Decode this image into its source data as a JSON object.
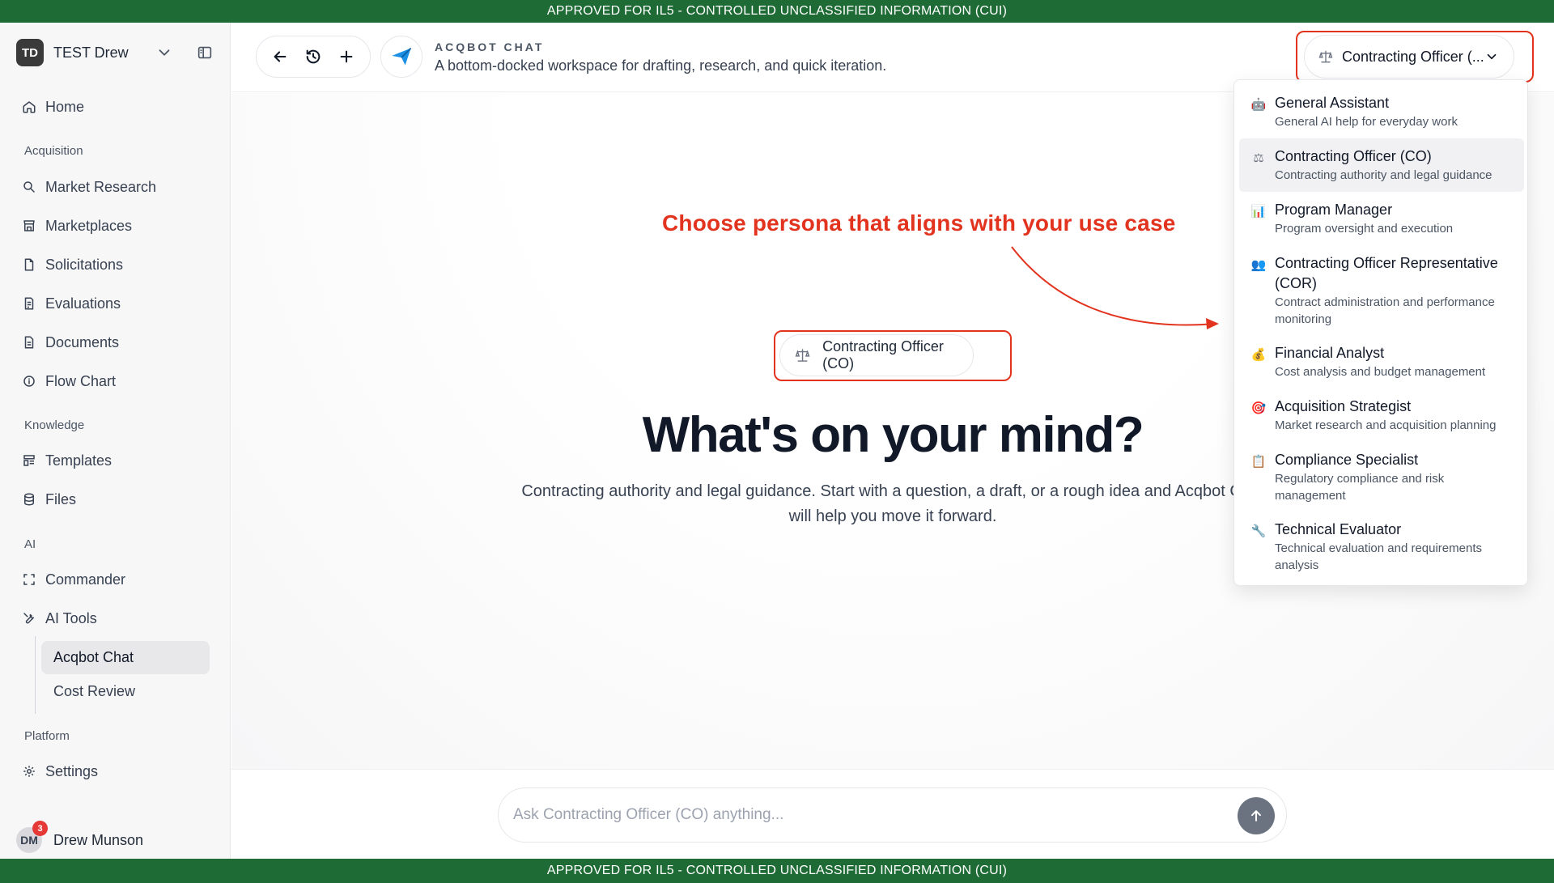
{
  "banner": {
    "top_text": "APPROVED FOR IL5 - CONTROLLED UNCLASSIFIED INFORMATION (CUI)",
    "bottom_text": "APPROVED FOR IL5 - CONTROLLED UNCLASSIFIED INFORMATION (CUI)",
    "color": "#1e6b35"
  },
  "workspace": {
    "initials": "TD",
    "name": "TEST Drew"
  },
  "sidebar": {
    "home": "Home",
    "sections": {
      "acquisition": "Acquisition",
      "knowledge": "Knowledge",
      "ai": "AI",
      "platform": "Platform"
    },
    "acquisition_items": [
      "Market Research",
      "Marketplaces",
      "Solicitations",
      "Evaluations",
      "Documents",
      "Flow Chart"
    ],
    "knowledge_items": [
      "Templates",
      "Files"
    ],
    "ai_items": [
      "Commander",
      "AI Tools"
    ],
    "ai_tools_sub": [
      "Acqbot Chat",
      "Cost Review"
    ],
    "platform_items": [
      "Settings"
    ]
  },
  "user": {
    "initials": "DM",
    "name": "Drew Munson",
    "notifications": "3"
  },
  "header": {
    "app_kicker": "ACQBOT CHAT",
    "app_description": "A bottom-docked workspace for drafting, research, and quick iteration.",
    "persona_selected_label": "Contracting Officer (..."
  },
  "personas": [
    {
      "icon": "robot-icon",
      "emoji": "🤖",
      "title": "General Assistant",
      "subtitle": "General AI help for everyday work"
    },
    {
      "icon": "scales-icon",
      "emoji": "⚖",
      "title": "Contracting Officer (CO)",
      "subtitle": "Contracting authority and legal guidance"
    },
    {
      "icon": "chart-icon",
      "emoji": "📊",
      "title": "Program Manager",
      "subtitle": "Program oversight and execution"
    },
    {
      "icon": "people-icon",
      "emoji": "👥",
      "title": "Contracting Officer Representative (COR)",
      "subtitle": "Contract administration and performance monitoring"
    },
    {
      "icon": "money-bag-icon",
      "emoji": "💰",
      "title": "Financial Analyst",
      "subtitle": "Cost analysis and budget management"
    },
    {
      "icon": "target-icon",
      "emoji": "🎯",
      "title": "Acquisition Strategist",
      "subtitle": "Market research and acquisition planning"
    },
    {
      "icon": "clipboard-icon",
      "emoji": "📋",
      "title": "Compliance Specialist",
      "subtitle": "Regulatory compliance and risk management"
    },
    {
      "icon": "wrench-icon",
      "emoji": "🔧",
      "title": "Technical Evaluator",
      "subtitle": "Technical evaluation and requirements analysis"
    }
  ],
  "main": {
    "annotation": "Choose persona that aligns with your use case",
    "persona_pill": "Contracting Officer (CO)",
    "headline": "What's on your mind?",
    "subheadline": "Contracting authority and legal guidance. Start with a question, a draft, or a rough idea and Acqbot Chat will help you move it forward."
  },
  "composer": {
    "placeholder": "Ask Contracting Officer (CO) anything..."
  },
  "colors": {
    "annotation_red": "#e2331f",
    "send_button": "#6b7280",
    "logo_blue": "#1a8fe3"
  }
}
